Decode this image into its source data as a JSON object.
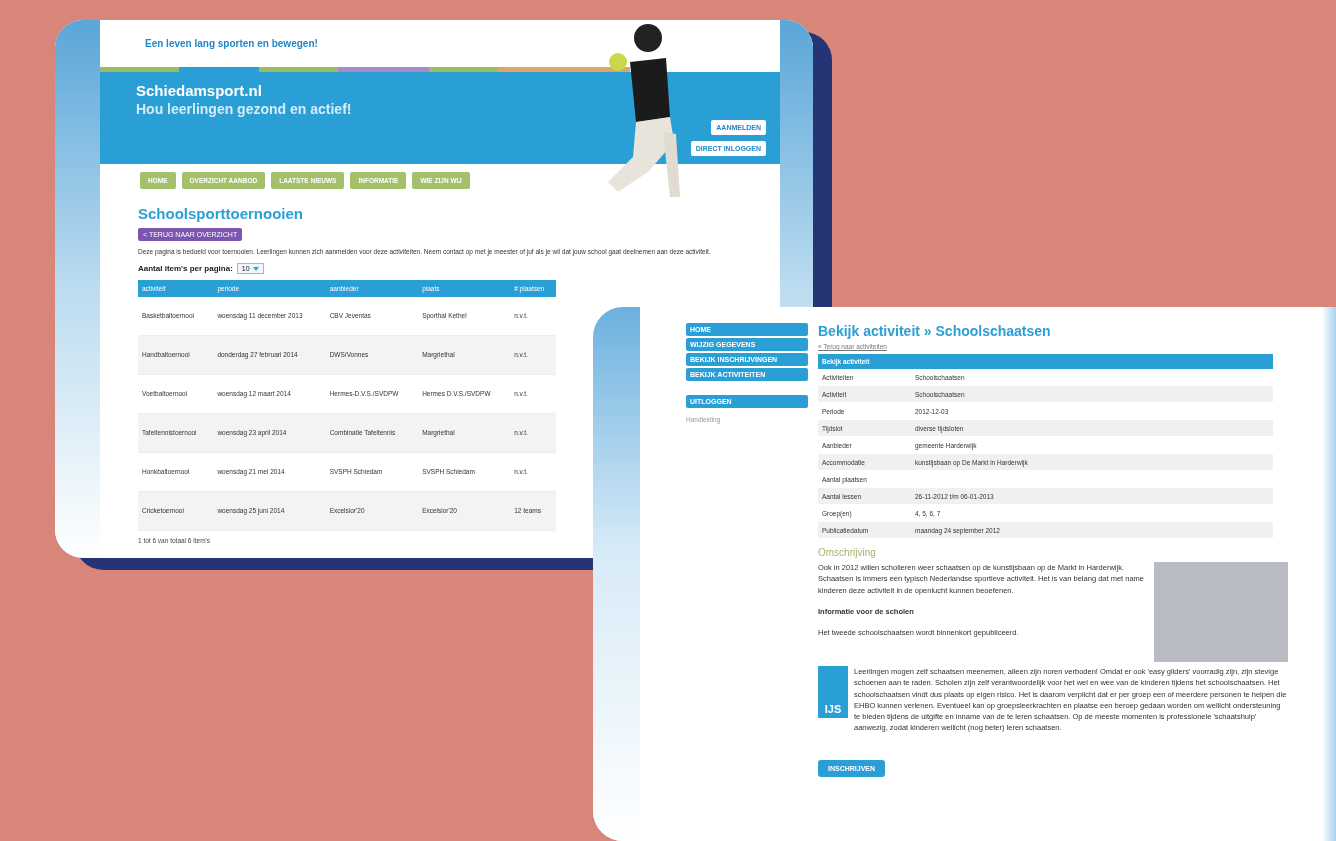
{
  "site_window": {
    "tagline": "Een leven lang sporten en bewegen!",
    "site_name": "Schiedamsport.nl",
    "slogan": "Hou leerlingen gezond en actief!",
    "header_buttons": [
      "AANMELDEN",
      "DIRECT INLOGGEN"
    ],
    "nav": [
      "HOME",
      "OVERZICHT AANBOD",
      "LAATSTE NIEUWS",
      "INFORMATIE",
      "WIE ZIJN WIJ"
    ],
    "title": "Schoolsporttoernooien",
    "back_button": "< TERUG NAAR OVERZICHT",
    "intro": "Deze pagina is bedoeld voor toernooien. Leerlingen kunnen zich aanmelden voor deze activiteiten. Neem contact op met je meester of juf als je wil dat jouw school gaat deelnemen aan deze activiteit.",
    "per_page": {
      "label": "Aantal item's per pagina:",
      "value": "10"
    },
    "table": {
      "columns": [
        "activiteit",
        "periode",
        "aanbieder",
        "plaats",
        "# plaatsen"
      ],
      "rows": [
        [
          "Basketbaltoernooi",
          "woensdag 11 december 2013",
          "CBV Jeventas",
          "Sporthal Kethel",
          "n.v.t."
        ],
        [
          "Handbaltoernooi",
          "donderdag 27 februari 2014",
          "DWS/Vonnes",
          "Margriethal",
          "n.v.t."
        ],
        [
          "Voetbaltoernooi",
          "woensdag 12 maart 2014",
          "Hermes-D.V.S./SVDPW",
          "Hermes D.V.S./SVDPW",
          "n.v.t."
        ],
        [
          "Tafeltennistoernooi",
          "woensdag 23 april 2014",
          "Combinatie Tafeltennis",
          "Margriethal",
          "n.v.t."
        ],
        [
          "Honkbaltoernooi",
          "woensdag 21 mei 2014",
          "SVSPH Schiedam",
          "SVSPH Schiedam",
          "n.v.t."
        ],
        [
          "Cricketoernooi",
          "woensdag 25 juni 2014",
          "Excelsior'20",
          "Excelsior'20",
          "12 teams"
        ]
      ]
    },
    "footer": "1 tot 6 van totaal 6 item's"
  },
  "detail_window": {
    "sidebar": {
      "items": [
        {
          "label": "HOME",
          "kind": "nav"
        },
        {
          "label": "WIJZIG GEGEVENS",
          "kind": "nav"
        },
        {
          "label": "BEKIJK INSCHRIJVINGEN",
          "kind": "nav"
        },
        {
          "label": "BEKIJK ACTIVITEITEN",
          "kind": "nav"
        },
        {
          "label": "UITLOGGEN",
          "kind": "logout"
        }
      ],
      "link": "Handleiding"
    },
    "title": "Bekijk activiteit » Schoolschaatsen",
    "back_link": "« Terug naar activiteiten",
    "table": {
      "heading": "Bekijk activiteit",
      "rows": [
        {
          "label": "Activiteiten",
          "value": "Schoolschaatsen"
        },
        {
          "label": "Activiteit",
          "value": "Schoolschaatsen"
        },
        {
          "label": "Periode",
          "value": "2012-12-03"
        },
        {
          "label": "Tijdslot",
          "value": "diverse tijdsloten"
        },
        {
          "label": "Aanbieder",
          "value": "gemeente Harderwijk"
        },
        {
          "label": "Accommodatie",
          "value": "kunstijsbaan op De Markt in Harderwijk"
        },
        {
          "label": "Aantal plaatsen"
        },
        {
          "label": "Aantal lessen",
          "value": "26-11-2012 t/m 06-01-2013"
        },
        {
          "label": "Groep(en)",
          "value": "4, 5, 6, 7"
        },
        {
          "label": "Publicatiedatum",
          "value": "maandag 24 september 2012"
        }
      ]
    },
    "description_heading": "Omschrijving",
    "paragraph_1": "Ook in 2012 willen scholieren weer schaatsen op de kunstijsbaan op de Markt in Harderwijk. Schaatsen is immers een typisch Nederlandse sportieve activiteit. Het is van belang dat met name kinderen deze activiteit in de openlucht kunnen beoefenen.",
    "info_heading": "Informatie voor de scholen",
    "paragraph_2": "Het tweede schoolschaatsen wordt binnenkort gepubliceerd.",
    "logo_text": "IJS",
    "paragraph_3": "Leerlingen mogen zelf schaatsen meenemen, alleen zijn noren verboden! Omdat er ook 'easy gliders' voorradig zijn, zijn stevige schoenen aan te raden. Scholen zijn zelf verantwoordelijk voor het wel en wee van de kinderen tijdens het schoolschaatsen. Het schoolschaatsen vindt dus plaats op eigen risico. Het is daarom verplicht dat er per groep een of meerdere personen te helpen die EHBO kunnen verlenen. Eventueel kan op groepsleerkrachten en plaatse een beroep gedaan worden om wellicht ondersteuning te bieden tijdens de uitgifte en inname van de te leren schaatsen. Op de meeste momenten is professionele 'schaatshulp' aanwezig, zodat kinderen wellicht (nog beter) leren schaatsen.",
    "submit_button": "INSCHRIJVEN"
  }
}
